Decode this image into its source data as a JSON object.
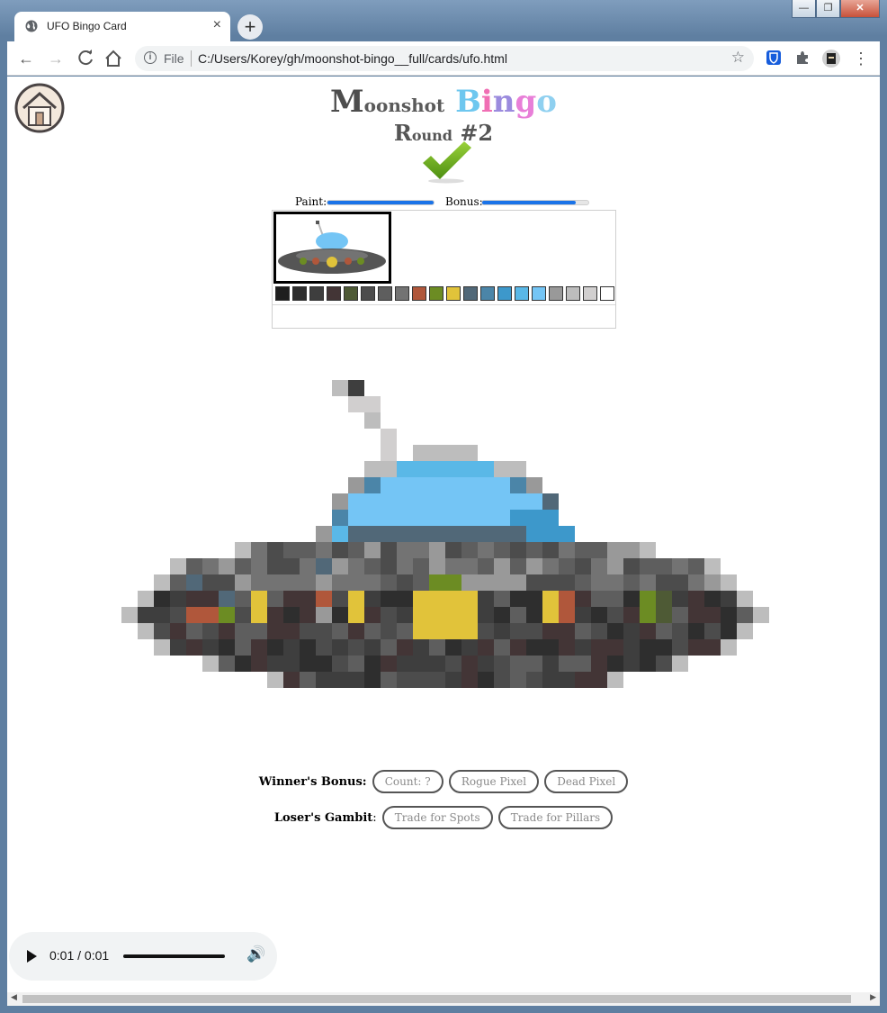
{
  "browser": {
    "tab_title": "UFO Bingo Card",
    "url_scheme": "File",
    "url": "C:/Users/Korey/gh/moonshot-bingo__full/cards/ufo.html",
    "new_tab": "+",
    "tab_close": "×"
  },
  "header": {
    "title_moonshot_first": "M",
    "title_moonshot_rest": "oonshot",
    "title_bingo": [
      "B",
      "i",
      "n",
      "g",
      "o"
    ],
    "round_first": "R",
    "round_rest": "ound",
    "round_number": "#2"
  },
  "progress": {
    "paint_label": "Paint:",
    "paint_level": 1.0,
    "bonus_label": "Bonus:",
    "bonus_level": 0.88
  },
  "palette": {
    "colors": [
      "#1e1e1e",
      "#2e2e2e",
      "#3e3e3e",
      "#433536",
      "#4e5a35",
      "#4c4c4c",
      "#5e5e5e",
      "#737373",
      "#b0573b",
      "#6c8c23",
      "#e1c33a",
      "#516878",
      "#4b85a8",
      "#3d98cb",
      "#5ab8e7",
      "#74c5f5",
      "#999999",
      "#bdbdbd",
      "#d1cfcf",
      "#ffffff"
    ]
  },
  "winners_bonus": {
    "label": "Winner's Bonus:",
    "buttons": [
      "Count: ?",
      "Rogue Pixel",
      "Dead Pixel"
    ]
  },
  "losers_gambit": {
    "label": "Loser's Gambit",
    "colon": ":",
    "buttons": [
      "Trade for Spots",
      "Trade for Pillars"
    ]
  },
  "audio": {
    "time": "0:01 / 0:01"
  },
  "colors": {
    "accent": "#1a73e8",
    "bingo_blue": "#6ec7ef",
    "bingo_pink": "#f06fb4",
    "check_green": "#6fb31e"
  }
}
